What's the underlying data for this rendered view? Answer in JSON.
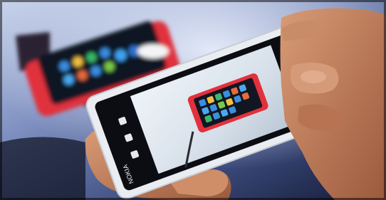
{
  "image": {
    "subject": "photo",
    "phone_brand_text": "NOKIA",
    "palette": {
      "background": "#5a6a9a",
      "background_light": "#b8c8e6",
      "white_phone": "#e9edf2",
      "red_phone": "#e2313c",
      "skin": "#c8825e",
      "screen": "#0c0d12",
      "viewfinder": "#dfe6ef",
      "app_blue": "#2f7fd6"
    },
    "icons": [
      "camera-icon",
      "flash-icon",
      "settings-icon",
      "shutter-icon",
      "video-icon",
      "back-icon"
    ]
  }
}
